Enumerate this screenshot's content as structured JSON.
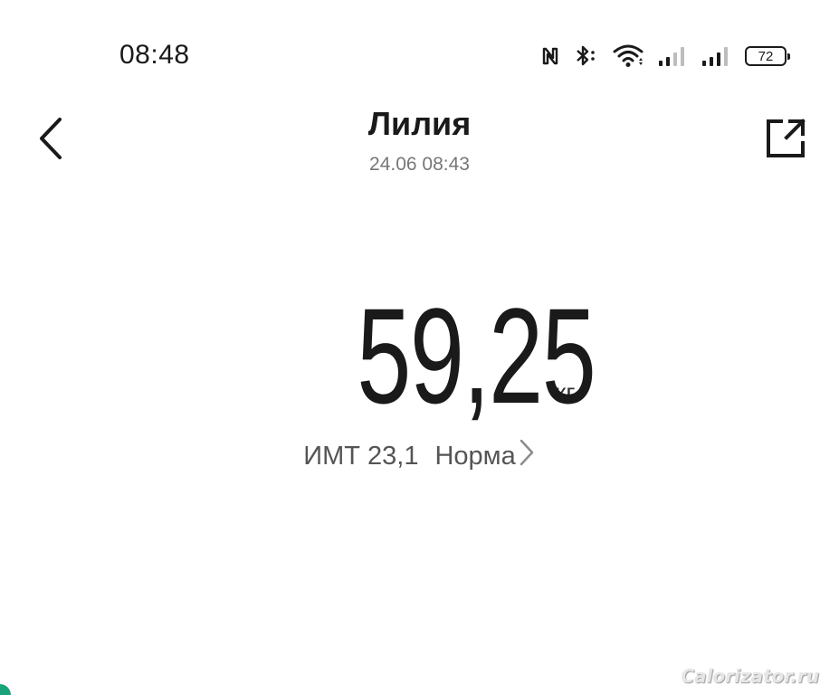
{
  "status_bar": {
    "time": "08:48",
    "battery_level": "72",
    "icons": [
      "nfc-icon",
      "bluetooth-icon",
      "wifi-icon",
      "signal-1-icon",
      "signal-2-icon",
      "battery-icon"
    ]
  },
  "header": {
    "title": "Лилия",
    "subtitle": "24.06 08:43",
    "back_icon": "chevron-left-icon",
    "share_icon": "share-out-icon"
  },
  "weight": {
    "value": "59,25",
    "unit": "кг"
  },
  "bmi": {
    "label": "ИМТ 23,1",
    "status": "Норма",
    "chevron_icon": "chevron-right-icon"
  },
  "watermark": {
    "text": "Calorizator.ru"
  },
  "colors": {
    "text_primary": "#1a1a1a",
    "text_secondary": "#777777",
    "accent_green": "#1aa37a",
    "background": "#ffffff"
  }
}
